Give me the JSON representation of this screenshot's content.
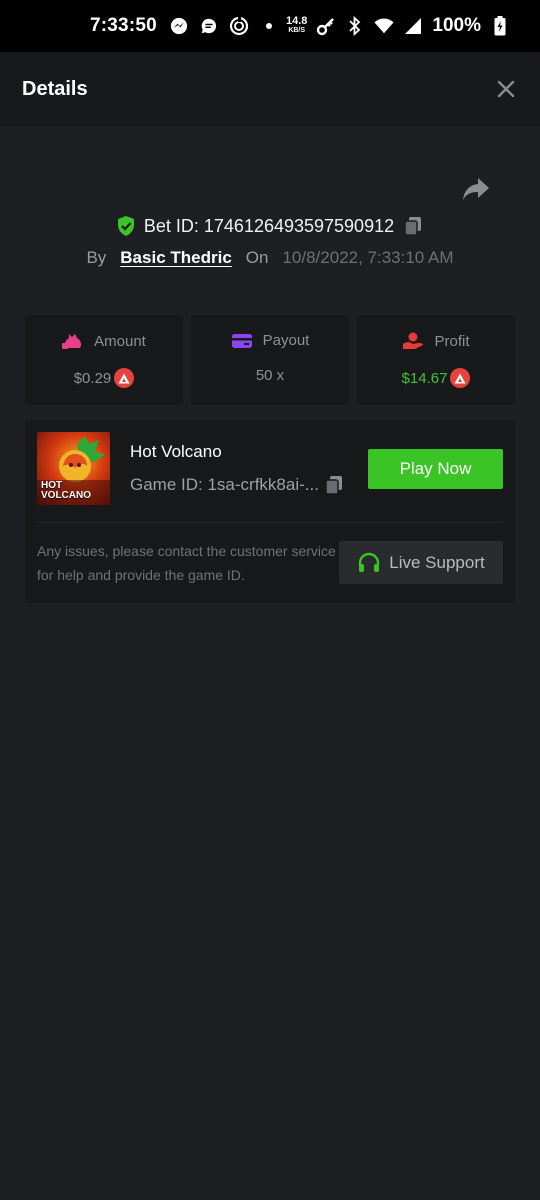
{
  "status_bar": {
    "time": "7:33:50",
    "net_speed_value": "14.8",
    "net_speed_unit": "KB/S",
    "battery": "100%"
  },
  "header": {
    "title": "Details"
  },
  "bet": {
    "id_label": "Bet ID: 1746126493597590912",
    "by_label": "By",
    "user": "Basic Thedric",
    "on_label": "On",
    "date": "10/8/2022, 7:33:10 AM"
  },
  "stats": {
    "amount_label": "Amount",
    "amount_value": "$0.29",
    "payout_label": "Payout",
    "payout_value": "50 x",
    "profit_label": "Profit",
    "profit_value": "$14.67"
  },
  "game": {
    "thumb_line1": "HOT",
    "thumb_line2": "VOLCANO",
    "name": "Hot Volcano",
    "id_label": "Game ID: 1sa-crfkk8ai-...",
    "play_label": "Play Now",
    "issue_text": "Any issues, please contact the customer service for help and provide the game ID.",
    "support_label": "Live Support"
  },
  "colors": {
    "accent_green": "#3ac425",
    "profit_green": "#3dc62b",
    "coin_red": "#e8423e",
    "amount_pink": "#e8408a",
    "payout_purple": "#8a47f0",
    "profit_red": "#e83a36"
  }
}
